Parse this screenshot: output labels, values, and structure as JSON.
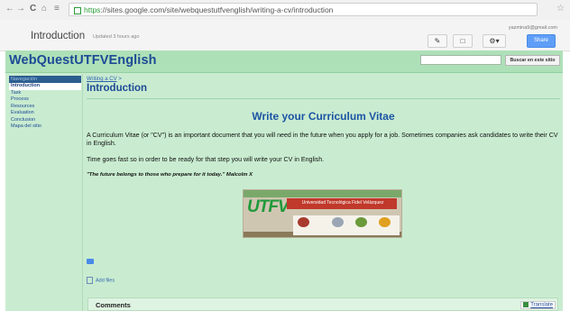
{
  "browser": {
    "url_scheme": "https",
    "url_rest": "://sites.google.com/site/webquestutfvenglish/writing-a-cv/introduction"
  },
  "googlesites": {
    "page_title": "Introduction",
    "updated": "Updated 3 hours ago",
    "user_email": "yazmina9@gmail.com",
    "share_label": "Share"
  },
  "site": {
    "title": "WebQuestUTFVEnglish",
    "search_button": "Buscar en este sitio"
  },
  "sidebar": {
    "heading": "Navegación",
    "items": [
      "Introduction",
      "Task",
      "Process",
      "Resources",
      "Evaluation",
      "Conclusion",
      "Mapa del sitio"
    ]
  },
  "page": {
    "breadcrumb_link": "Writing a CV",
    "breadcrumb_sep": ">",
    "title": "Introduction",
    "heading": "Write your Curriculum Vitae",
    "para1": "A Curriculum Vitae (or \"CV\") is an important document that you will need in the future when you apply for a job. Sometimes companies ask candidates to write their CV in English.",
    "para2": "Time goes fast so in order to be ready for that step you will write your CV in English.",
    "quote": "\"The future belongs to those who prepare for it today.\" Malcolm X",
    "banner_logo": "UTFV",
    "banner_text": "Universidad Tecnológica Fidel Velázquez",
    "add_files": "Add files",
    "comments": "Comments",
    "translate": "Translate"
  },
  "colors": {
    "site_bg": "#c9ecd0",
    "site_title": "#1d4a96",
    "nav_head_bg": "#2c5d8f",
    "share_bg": "#5f9ef7"
  }
}
